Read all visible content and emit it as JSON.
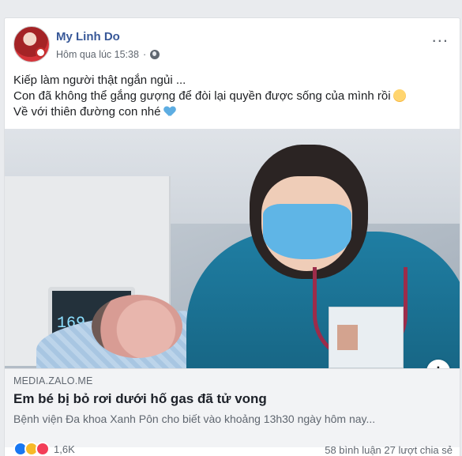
{
  "post": {
    "author": "My Linh Do",
    "timestamp": "Hôm qua lúc 15:38",
    "privacy_icon": "globe-icon",
    "text_lines": [
      "Kiếp làm người thật ngắn ngủi ...",
      "Con đã không thể gắng gượng để đòi lại quyền được sống của mình rồi",
      "Về với thiên đường con nhé"
    ],
    "monitor_reading": "169"
  },
  "link": {
    "domain": "MEDIA.ZALO.ME",
    "title": "Em bé bị bỏ rơi dưới hố gas đã tử vong",
    "description": "Bệnh viện Đa khoa Xanh Pôn cho biết vào khoảng 13h30 ngày hôm nay..."
  },
  "engagement": {
    "reaction_count": "1,6K",
    "comments_shares": "58 bình luận 27 lượt chia sẻ"
  },
  "colors": {
    "author": "#385898",
    "page_bg": "#e9ebee",
    "link_bg": "#f2f3f5"
  }
}
